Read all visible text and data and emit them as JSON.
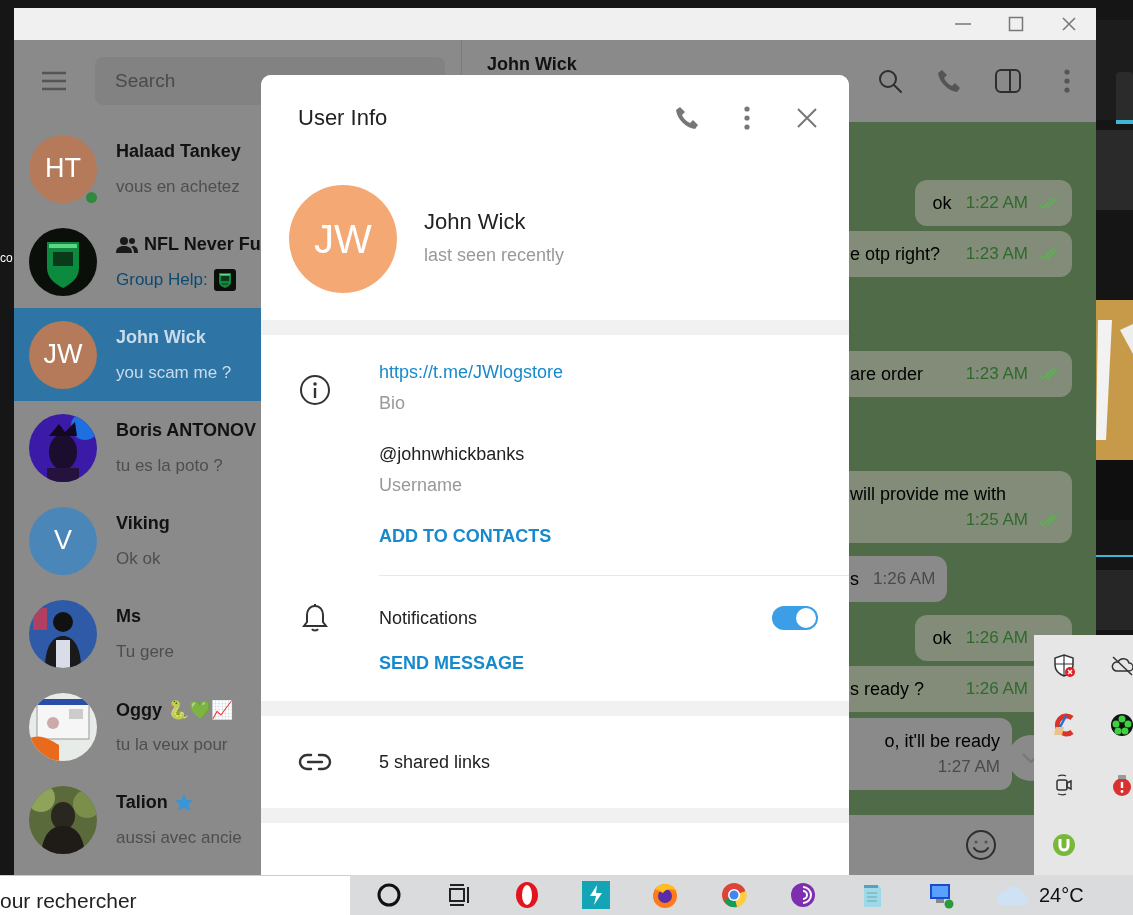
{
  "desktop": {
    "edge_text": "co"
  },
  "sidebar": {
    "search": {
      "placeholder": "Search"
    },
    "chats": [
      {
        "name": "Halaad Tankey",
        "preview": "vous en achetez",
        "avatar": {
          "kind": "initials",
          "initials": "HT",
          "color": "#b47a5a"
        },
        "online": true,
        "selected": false
      },
      {
        "name": "NFL Never Fu",
        "preview_sender": "Group Help:",
        "group": true,
        "selected": false
      },
      {
        "name": "John Wick",
        "preview": "you scam me ?",
        "avatar": {
          "kind": "initials",
          "initials": "JW",
          "color": "#b47a5a"
        },
        "selected": true
      },
      {
        "name": "Boris ANTONOV",
        "preview": "tu es la poto ?",
        "selected": false
      },
      {
        "name": "Viking",
        "preview": "Ok ok",
        "avatar": {
          "kind": "initials",
          "initials": "V",
          "color": "#4b86b8"
        },
        "selected": false
      },
      {
        "name": "Ms",
        "preview": "Tu gere",
        "selected": false
      },
      {
        "name": "Oggy 🐍💚📈",
        "preview": "tu la veux pour",
        "selected": false
      },
      {
        "name": "Talion",
        "premium": true,
        "preview": "aussi avec ancie",
        "selected": false
      }
    ]
  },
  "chat": {
    "title": "John Wick",
    "messages": [
      {
        "kind": "out",
        "text": "ok",
        "time": "1:22 AM",
        "read": true
      },
      {
        "kind": "out",
        "cut": true,
        "text": "e otp right?",
        "time": "1:23 AM",
        "read": true
      },
      {
        "kind": "out",
        "cut": true,
        "text": "are order",
        "time": "1:23 AM",
        "read": true
      },
      {
        "kind": "out",
        "cut": true,
        "text": "will provide me with",
        "time": "1:25 AM",
        "read": true
      },
      {
        "kind": "in",
        "cut": true,
        "text": "s",
        "time": "1:26 AM"
      },
      {
        "kind": "out",
        "text": "ok",
        "time": "1:26 AM"
      },
      {
        "kind": "out",
        "cut": true,
        "text": "s ready ?",
        "time": "1:26 AM"
      },
      {
        "kind": "in",
        "cut": true,
        "text": "o, it'll be ready",
        "time": "1:27 AM"
      }
    ]
  },
  "user_info": {
    "title": "User Info",
    "avatar": {
      "initials": "JW",
      "color": "#f4a974"
    },
    "name": "John Wick",
    "status": "last seen recently",
    "link": "https://t.me/JWlogstore",
    "link_label": "Bio",
    "username": "@johnwhickbanks",
    "username_label": "Username",
    "add_button": "ADD TO CONTACTS",
    "notifications": {
      "label": "Notifications",
      "on": true
    },
    "send_button": "SEND MESSAGE",
    "shared_links": "5 shared links"
  },
  "taskbar": {
    "search": {
      "placeholder": "our rechercher"
    },
    "temperature": "24°C"
  }
}
